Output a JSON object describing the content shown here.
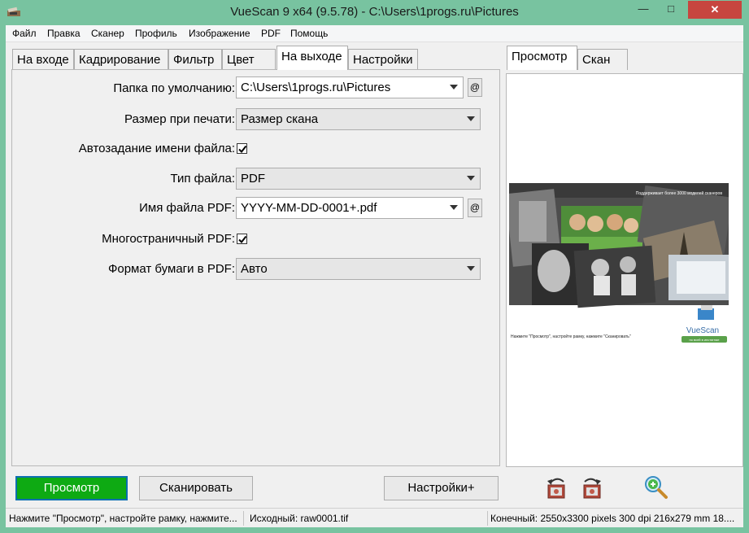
{
  "window": {
    "title": "VueScan 9 x64 (9.5.78) - C:\\Users\\1progs.ru\\Pictures",
    "minimize_glyph": "—",
    "maximize_glyph": "□",
    "close_glyph": "✕"
  },
  "menu": [
    "Файл",
    "Правка",
    "Сканер",
    "Профиль",
    "Изображение",
    "PDF",
    "Помощь"
  ],
  "tabs": [
    {
      "label": "На входе",
      "active": false
    },
    {
      "label": "Кадрирование",
      "active": false
    },
    {
      "label": "Фильтр",
      "active": false
    },
    {
      "label": "Цвет",
      "active": false
    },
    {
      "label": "На выходе",
      "active": true
    },
    {
      "label": "Настройки",
      "active": false
    }
  ],
  "settings": {
    "default_folder": {
      "label": "Папка по умолчанию:",
      "value": "C:\\Users\\1progs.ru\\Pictures"
    },
    "print_size": {
      "label": "Размер при печати:",
      "value": "Размер скана"
    },
    "auto_filename": {
      "label": "Автозадание имени файла:",
      "checked": true
    },
    "file_type": {
      "label": "Тип файла:",
      "value": "PDF"
    },
    "pdf_filename": {
      "label": "Имя файла PDF:",
      "value": "YYYY-MM-DD-0001+.pdf"
    },
    "multipage_pdf": {
      "label": "Многостраничный PDF:",
      "checked": true
    },
    "pdf_paper_format": {
      "label": "Формат бумаги в PDF:",
      "value": "Авто"
    },
    "at_label": "@"
  },
  "preview_tabs": [
    {
      "label": "Просмотр",
      "active": true
    },
    {
      "label": "Скан",
      "active": false
    }
  ],
  "preview": {
    "banner_text": "Поддерживает более 3000 моделей сканеров",
    "hint_text": "Нажмите \"Просмотр\", настройте рамку, нажмите \"Сканировать\"",
    "logo_text": "VueScan",
    "logo_tagline": "по всей в инстигнае"
  },
  "buttons": {
    "preview": "Просмотр",
    "scan": "Сканировать",
    "settings_plus": "Настройки+"
  },
  "tools": [
    "rotate-left-icon",
    "rotate-right-icon",
    "zoom-in-icon"
  ],
  "status": {
    "hint": "Нажмите \"Просмотр\", настройте рамку, нажмите...",
    "source": "Исходный: raw0001.tif",
    "output": "Конечный: 2550x3300 pixels 300 dpi 216x279 mm 18...."
  },
  "colors": {
    "window_frame": "#78c3a0",
    "preview_button": "#0eaa13",
    "close_button": "#c7463f"
  }
}
